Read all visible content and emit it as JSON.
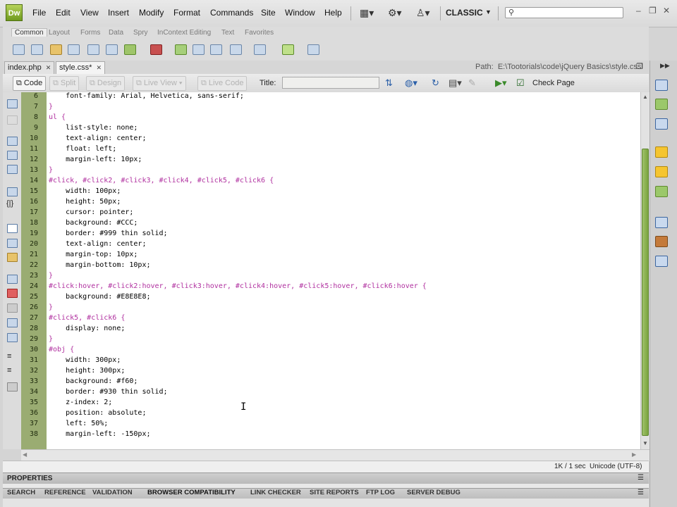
{
  "app": {
    "logo_text": "Dw"
  },
  "menu": [
    "File",
    "Edit",
    "View",
    "Insert",
    "Modify",
    "Format",
    "Commands",
    "Site",
    "Window",
    "Help"
  ],
  "workspace": {
    "label": "CLASSIC"
  },
  "search": {
    "icon": "search-icon"
  },
  "insert_panel": {
    "tabs": [
      "Common",
      "Layout",
      "Forms",
      "Data",
      "Spry",
      "InContext Editing",
      "Text",
      "Favorites"
    ],
    "active_tab": "Common"
  },
  "doc_tabs": [
    {
      "label": "index.php"
    },
    {
      "label": "style.css*"
    }
  ],
  "path": {
    "label": "Path:",
    "value": "E:\\Tootorials\\code\\jQuery Basics\\style.css"
  },
  "doc_toolbar": {
    "code": "Code",
    "split": "Split",
    "design": "Design",
    "live_view": "Live View",
    "live_code": "Live Code",
    "title_label": "Title:",
    "title_value": "",
    "check_page": "Check Page"
  },
  "code_lines": [
    {
      "n": "6",
      "t": "    font-family: Arial, Helvetica, sans-serif;",
      "k": "prop"
    },
    {
      "n": "7",
      "t": "}",
      "k": "punc"
    },
    {
      "n": "8",
      "t": "ul {",
      "k": "sel"
    },
    {
      "n": "9",
      "t": "    list-style: none;",
      "k": "prop"
    },
    {
      "n": "10",
      "t": "    text-align: center;",
      "k": "prop"
    },
    {
      "n": "11",
      "t": "    float: left;",
      "k": "prop"
    },
    {
      "n": "12",
      "t": "    margin-left: 10px;",
      "k": "prop"
    },
    {
      "n": "13",
      "t": "}",
      "k": "punc"
    },
    {
      "n": "14",
      "t": "#click, #click2, #click3, #click4, #click5, #click6 {",
      "k": "sel"
    },
    {
      "n": "15",
      "t": "    width: 100px;",
      "k": "prop"
    },
    {
      "n": "16",
      "t": "    height: 50px;",
      "k": "prop"
    },
    {
      "n": "17",
      "t": "    cursor: pointer;",
      "k": "prop"
    },
    {
      "n": "18",
      "t": "    background: #CCC;",
      "k": "prop"
    },
    {
      "n": "19",
      "t": "    border: #999 thin solid;",
      "k": "prop"
    },
    {
      "n": "20",
      "t": "    text-align: center;",
      "k": "prop"
    },
    {
      "n": "21",
      "t": "    margin-top: 10px;",
      "k": "prop"
    },
    {
      "n": "22",
      "t": "    margin-bottom: 10px;",
      "k": "prop"
    },
    {
      "n": "23",
      "t": "}",
      "k": "punc"
    },
    {
      "n": "24",
      "t": "#click:hover, #click2:hover, #click3:hover, #click4:hover, #click5:hover, #click6:hover {",
      "k": "sel"
    },
    {
      "n": "25",
      "t": "    background: #E8E8E8;",
      "k": "prop"
    },
    {
      "n": "26",
      "t": "}",
      "k": "punc"
    },
    {
      "n": "27",
      "t": "#click5, #click6 {",
      "k": "sel"
    },
    {
      "n": "28",
      "t": "    display: none;",
      "k": "prop"
    },
    {
      "n": "29",
      "t": "}",
      "k": "punc"
    },
    {
      "n": "30",
      "t": "#obj {",
      "k": "sel"
    },
    {
      "n": "31",
      "t": "    width: 300px;",
      "k": "prop"
    },
    {
      "n": "32",
      "t": "    height: 300px;",
      "k": "prop"
    },
    {
      "n": "33",
      "t": "    background: #f60;",
      "k": "prop"
    },
    {
      "n": "34",
      "t": "    border: #930 thin solid;",
      "k": "prop"
    },
    {
      "n": "35",
      "t": "    z-index: 2;",
      "k": "prop"
    },
    {
      "n": "36",
      "t": "    position: absolute;",
      "k": "prop"
    },
    {
      "n": "37",
      "t": "    left: 50%;",
      "k": "prop"
    },
    {
      "n": "38",
      "t": "    margin-left: -150px;",
      "k": "prop"
    }
  ],
  "status": {
    "size": "1K / 1 sec",
    "encoding": "Unicode (UTF-8)"
  },
  "properties": {
    "label": "PROPERTIES"
  },
  "results_tabs": [
    "SEARCH",
    "REFERENCE",
    "VALIDATION",
    "BROWSER COMPATIBILITY",
    "LINK CHECKER",
    "SITE REPORTS",
    "FTP LOG",
    "SERVER DEBUG"
  ],
  "results_active": "BROWSER COMPATIBILITY",
  "colors": {
    "gutter": "#9aac72",
    "selector": "#b0309f",
    "scroll_thumb": "#79a33e"
  }
}
